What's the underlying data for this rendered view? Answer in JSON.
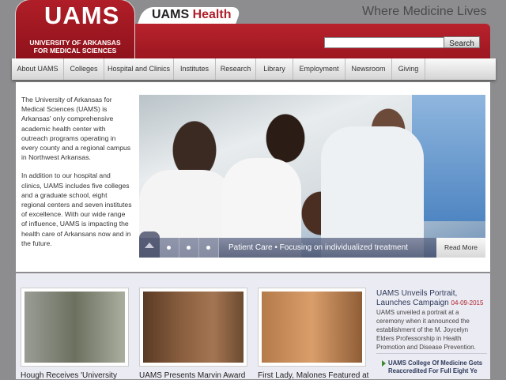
{
  "header": {
    "logo_text": "UAMS",
    "logo_sub1": "UNIVERSITY OF ARKANSAS",
    "logo_sub2": "FOR MEDICAL SCIENCES",
    "health_prefix": "UAMS ",
    "health_suffix": "Health",
    "tagline": "Where Medicine Lives",
    "search_value": "",
    "search_button": "Search"
  },
  "nav": {
    "items": [
      {
        "label": "About UAMS"
      },
      {
        "label": "Colleges"
      },
      {
        "label": "Hospital and Clinics"
      },
      {
        "label": "Institutes"
      },
      {
        "label": "Research"
      },
      {
        "label": "Library"
      },
      {
        "label": "Employment"
      },
      {
        "label": "Newsroom"
      },
      {
        "label": "Giving"
      }
    ]
  },
  "intro": {
    "p1": "The University of Arkansas for Medical Sciences (UAMS) is Arkansas' only comprehensive academic health center with outreach programs operating in every county and a regional campus in Northwest Arkansas.",
    "p2": "In addition to our hospital and clinics, UAMS includes five colleges and a graduate school, eight regional centers and seven institutes of excellence. With our wide range of influence, UAMS is impacting the health care of Arkansans now and in the future."
  },
  "hero": {
    "caption": "Patient Care • Focusing on individualized treatment",
    "read_more": "Read More"
  },
  "news": {
    "items": [
      {
        "title": "Hough Receives 'University"
      },
      {
        "title": "UAMS Presents Marvin Award"
      },
      {
        "title": "First Lady, Malones Featured at"
      }
    ],
    "feature": {
      "title": "UAMS Unveils Portrait, Launches Campaign",
      "date": "04-09-2015",
      "body": "UAMS unveiled a portrait at a ceremony when it announced the establishment of the M. Joycelyn Elders Professorship in Health Promotion and Disease Prevention.",
      "link": "UAMS College Of Medicine Gets Reaccredited For Full Eight Ye"
    }
  }
}
